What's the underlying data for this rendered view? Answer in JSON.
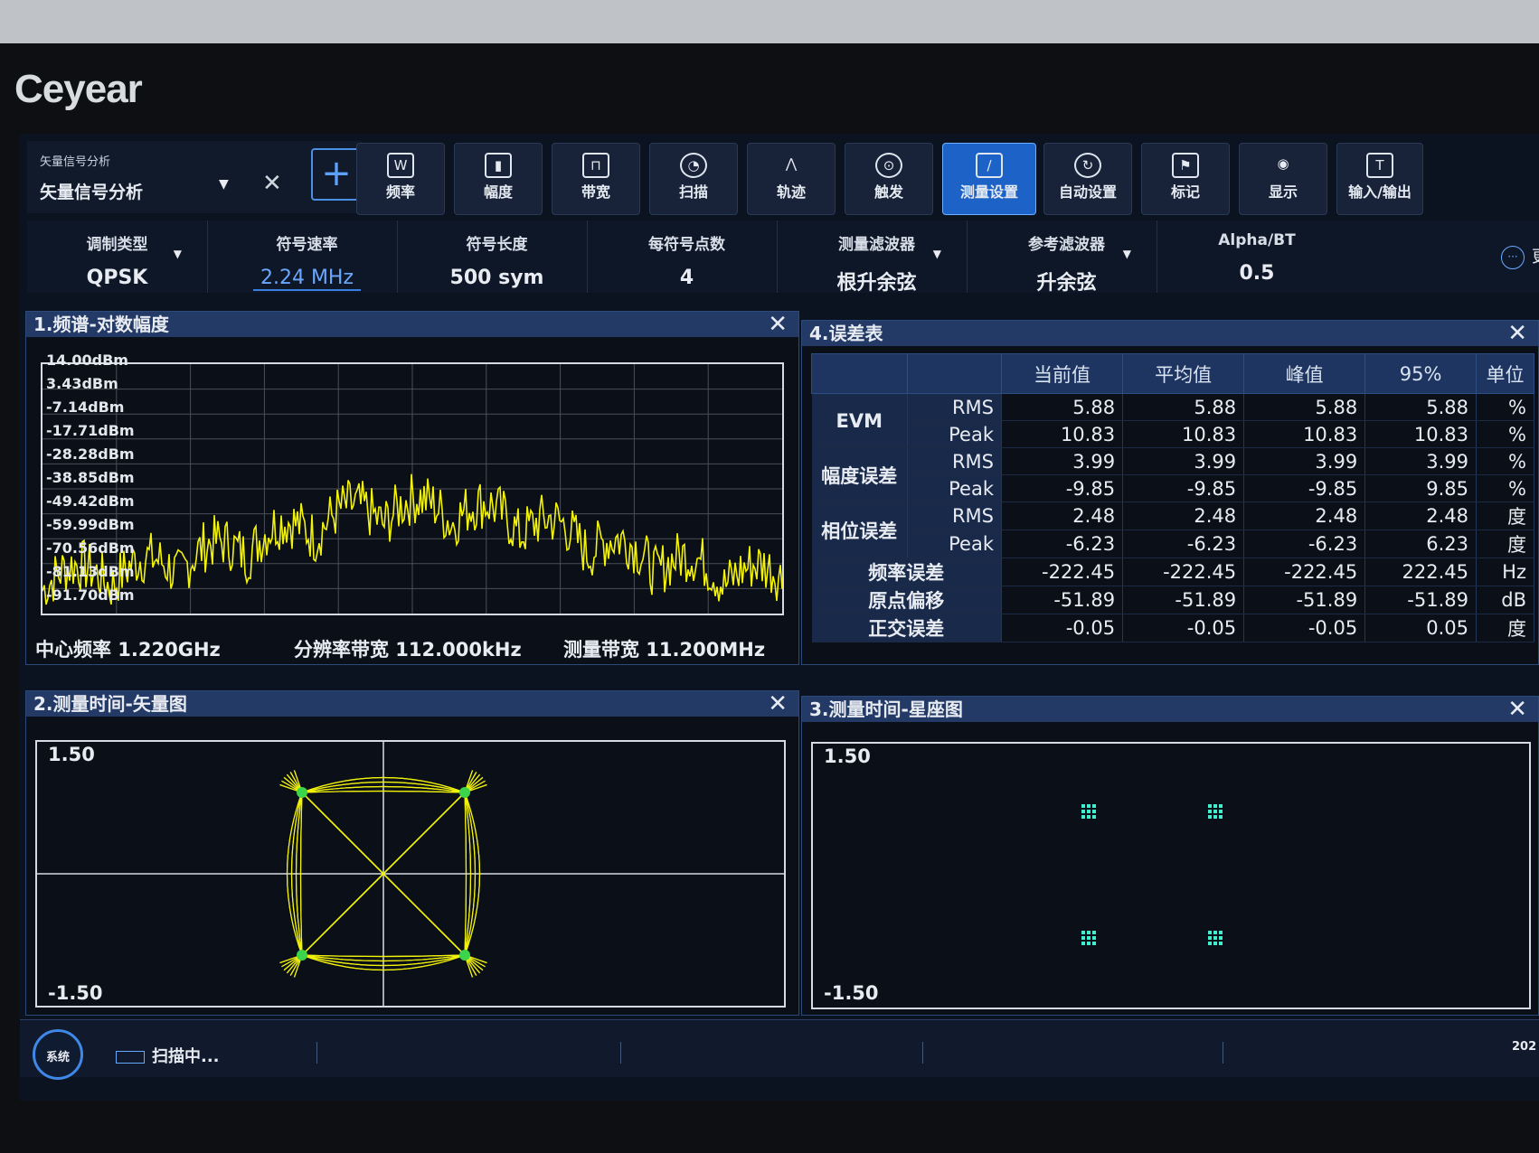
{
  "brand": "Ceyear",
  "mode": {
    "title": "矢量信号分析",
    "value": "矢量信号分析"
  },
  "toolbar": [
    "频率",
    "幅度",
    "带宽",
    "扫描",
    "轨迹",
    "触发",
    "测量设置",
    "自动设置",
    "标记",
    "显示",
    "输入/输出"
  ],
  "toolbar_active": "测量设置",
  "params": [
    {
      "label": "调制类型",
      "value": "QPSK"
    },
    {
      "label": "符号速率",
      "value": "2.24 MHz"
    },
    {
      "label": "符号长度",
      "value": "500 sym"
    },
    {
      "label": "每符号点数",
      "value": "4"
    },
    {
      "label": "测量滤波器",
      "value": "根升余弦"
    },
    {
      "label": "参考滤波器",
      "value": "升余弦"
    },
    {
      "label": "Alpha/BT",
      "value": "0.5"
    }
  ],
  "more": "更",
  "spectrum": {
    "title": "1.频谱-对数幅度",
    "y_labels": [
      "14.00dBm",
      "3.43dBm",
      "-7.14dBm",
      "-17.71dBm",
      "-28.28dBm",
      "-38.85dBm",
      "-49.42dBm",
      "-59.99dBm",
      "-70.56dBm",
      "-81.13dBm",
      "-91.70dBm"
    ],
    "center": "中心频率 1.220GHz",
    "rbw": "分辨率带宽 112.000kHz",
    "span": "测量带宽 11.200MHz",
    "trace_color": "#f2f20a"
  },
  "error_table": {
    "title": "4.误差表",
    "headers": [
      "",
      "",
      "当前值",
      "平均值",
      "峰值",
      "95%",
      "单位"
    ],
    "groups": [
      {
        "name": "EVM",
        "rows": [
          {
            "sub": "RMS",
            "vals": [
              "5.88",
              "5.88",
              "5.88",
              "5.88"
            ],
            "unit": "%"
          },
          {
            "sub": "Peak",
            "vals": [
              "10.83",
              "10.83",
              "10.83",
              "10.83"
            ],
            "unit": "%"
          }
        ]
      },
      {
        "name": "幅度误差",
        "rows": [
          {
            "sub": "RMS",
            "vals": [
              "3.99",
              "3.99",
              "3.99",
              "3.99"
            ],
            "unit": "%"
          },
          {
            "sub": "Peak",
            "vals": [
              "-9.85",
              "-9.85",
              "-9.85",
              "9.85"
            ],
            "unit": "%"
          }
        ]
      },
      {
        "name": "相位误差",
        "rows": [
          {
            "sub": "RMS",
            "vals": [
              "2.48",
              "2.48",
              "2.48",
              "2.48"
            ],
            "unit": "度"
          },
          {
            "sub": "Peak",
            "vals": [
              "-6.23",
              "-6.23",
              "-6.23",
              "6.23"
            ],
            "unit": "度"
          }
        ]
      }
    ],
    "single_rows": [
      {
        "name": "频率误差",
        "vals": [
          "-222.45",
          "-222.45",
          "-222.45",
          "222.45"
        ],
        "unit": "Hz"
      },
      {
        "name": "原点偏移",
        "vals": [
          "-51.89",
          "-51.89",
          "-51.89",
          "-51.89"
        ],
        "unit": "dB"
      },
      {
        "name": "正交误差",
        "vals": [
          "-0.05",
          "-0.05",
          "-0.05",
          "0.05"
        ],
        "unit": "度"
      }
    ]
  },
  "vector": {
    "title": "2.测量时间-矢量图",
    "ymax": "1.50",
    "ymin": "-1.50",
    "color": "#f2f20a"
  },
  "constellation": {
    "title": "3.测量时间-星座图",
    "ymax": "1.50",
    "ymin": "-1.50",
    "color": "#3ef0d0"
  },
  "status": {
    "system": "系统",
    "scanning": "扫描中...",
    "clock": "202"
  }
}
